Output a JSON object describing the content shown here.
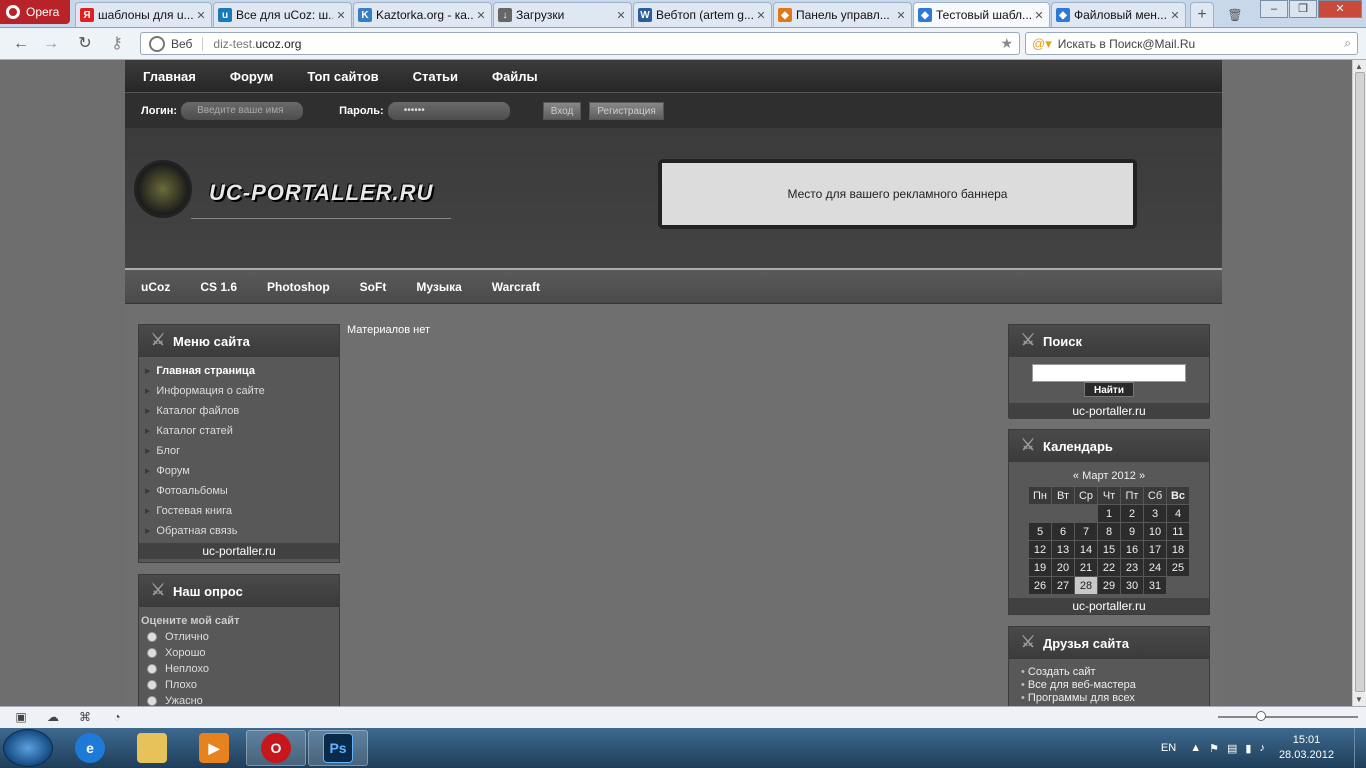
{
  "browser": {
    "app_button": "Opera",
    "tabs": [
      {
        "label": "шаблоны для u...",
        "fav": "Я",
        "color": "#e02020"
      },
      {
        "label": "Все для uCoz: ш...",
        "fav": "u",
        "color": "#1a7ab8"
      },
      {
        "label": "Kaztorka.org - ка...",
        "fav": "K",
        "color": "#3a7ec2"
      },
      {
        "label": "Загрузки",
        "fav": "↓",
        "color": "#666"
      },
      {
        "label": "Вебтоп (artem g...",
        "fav": "W",
        "color": "#2a5d99"
      },
      {
        "label": "Панель управл...",
        "fav": "◆",
        "color": "#e07818"
      },
      {
        "label": "Тестовый шабл...",
        "fav": "◆",
        "color": "#2c7ad6"
      },
      {
        "label": "Файловый мен...",
        "fav": "◆",
        "color": "#2c7ad6"
      }
    ],
    "address": {
      "prefix": "Веб",
      "url_gray": "diz-test.",
      "url_dark": "ucoz.org"
    },
    "search_placeholder": "Искать в Поиск@Mail.Ru"
  },
  "site": {
    "top_nav": [
      "Главная",
      "Форум",
      "Топ сайтов",
      "Статьи",
      "Файлы"
    ],
    "login": {
      "login_label": "Логин:",
      "login_placeholder": "Введите ваше имя",
      "password_label": "Пароль:",
      "password_value": "••••••",
      "enter_button": "Вход",
      "register_button": "Регистрация"
    },
    "logo_text": "UC-PORTALLER.RU",
    "banner_text": "Место для вашего рекламного баннера",
    "sub_nav": [
      "uCoz",
      "CS 1.6",
      "Photoshop",
      "SoFt",
      "Музыка",
      "Warcraft"
    ],
    "main_text": "Материалов нет",
    "menu": {
      "title": "Меню сайта",
      "items": [
        "Главная страница",
        "Информация о сайте",
        "Каталог файлов",
        "Каталог статей",
        "Блог",
        "Форум",
        "Фотоальбомы",
        "Гостевая книга",
        "Обратная связь"
      ],
      "footer": "uc-portaller.ru"
    },
    "poll": {
      "title": "Наш опрос",
      "question": "Оцените мой сайт",
      "options": [
        "Отлично",
        "Хорошо",
        "Неплохо",
        "Плохо",
        "Ужасно"
      ]
    },
    "search": {
      "title": "Поиск",
      "button": "Найти",
      "footer": "uc-portaller.ru"
    },
    "calendar": {
      "title": "Календарь",
      "prev": "«",
      "month": "Март 2012",
      "next": "»",
      "weekdays": [
        "Пн",
        "Вт",
        "Ср",
        "Чт",
        "Пт",
        "Сб",
        "Вс"
      ],
      "weeks": [
        [
          "",
          "",
          "",
          "1",
          "2",
          "3",
          "4"
        ],
        [
          "5",
          "6",
          "7",
          "8",
          "9",
          "10",
          "11"
        ],
        [
          "12",
          "13",
          "14",
          "15",
          "16",
          "17",
          "18"
        ],
        [
          "19",
          "20",
          "21",
          "22",
          "23",
          "24",
          "25"
        ],
        [
          "26",
          "27",
          "28",
          "29",
          "30",
          "31",
          ""
        ]
      ],
      "today": "28",
      "footer": "uc-portaller.ru"
    },
    "friends": {
      "title": "Друзья сайта",
      "items": [
        "Создать сайт",
        "Все для веб-мастера",
        "Программы для всех"
      ]
    }
  },
  "taskbar": {
    "lang": "EN",
    "time": "15:01",
    "date": "28.03.2012"
  }
}
